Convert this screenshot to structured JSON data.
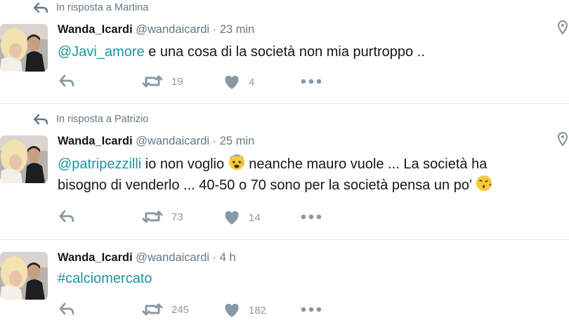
{
  "colors": {
    "accent": "#1b95a0",
    "muted": "#657786",
    "icon": "#8899a6",
    "divider": "#e1e8ed"
  },
  "tweets": [
    {
      "reply_context": "In risposta a Martina",
      "name": "Wanda_Icardi",
      "handle": "@wandaicardi",
      "separator": "·",
      "time": "23 min",
      "mention": "@Javi_amore",
      "text_line1": " e una cosa di la società non mia purtroppo ..",
      "retweets": "19",
      "likes": "4"
    },
    {
      "reply_context": "In risposta a Patrizio",
      "name": "Wanda_Icardi",
      "handle": "@wandaicardi",
      "separator": "·",
      "time": "25 min",
      "mention": "@patripezzilli",
      "text_part1": " io non voglio ",
      "emoji1": "anxious-face-emoji",
      "text_part2": " neanche mauro vuole ... La società ha",
      "text_line2": "bisogno di venderlo ... 40-50 o 70 sono per la società pensa un po' ",
      "emoji2": "kissing-face-emoji",
      "retweets": "73",
      "likes": "14"
    },
    {
      "name": "Wanda_Icardi",
      "handle": "@wandaicardi",
      "separator": "·",
      "time": "4 h",
      "hashtag": "#calciomercato",
      "retweets": "245",
      "likes": "182"
    }
  ]
}
